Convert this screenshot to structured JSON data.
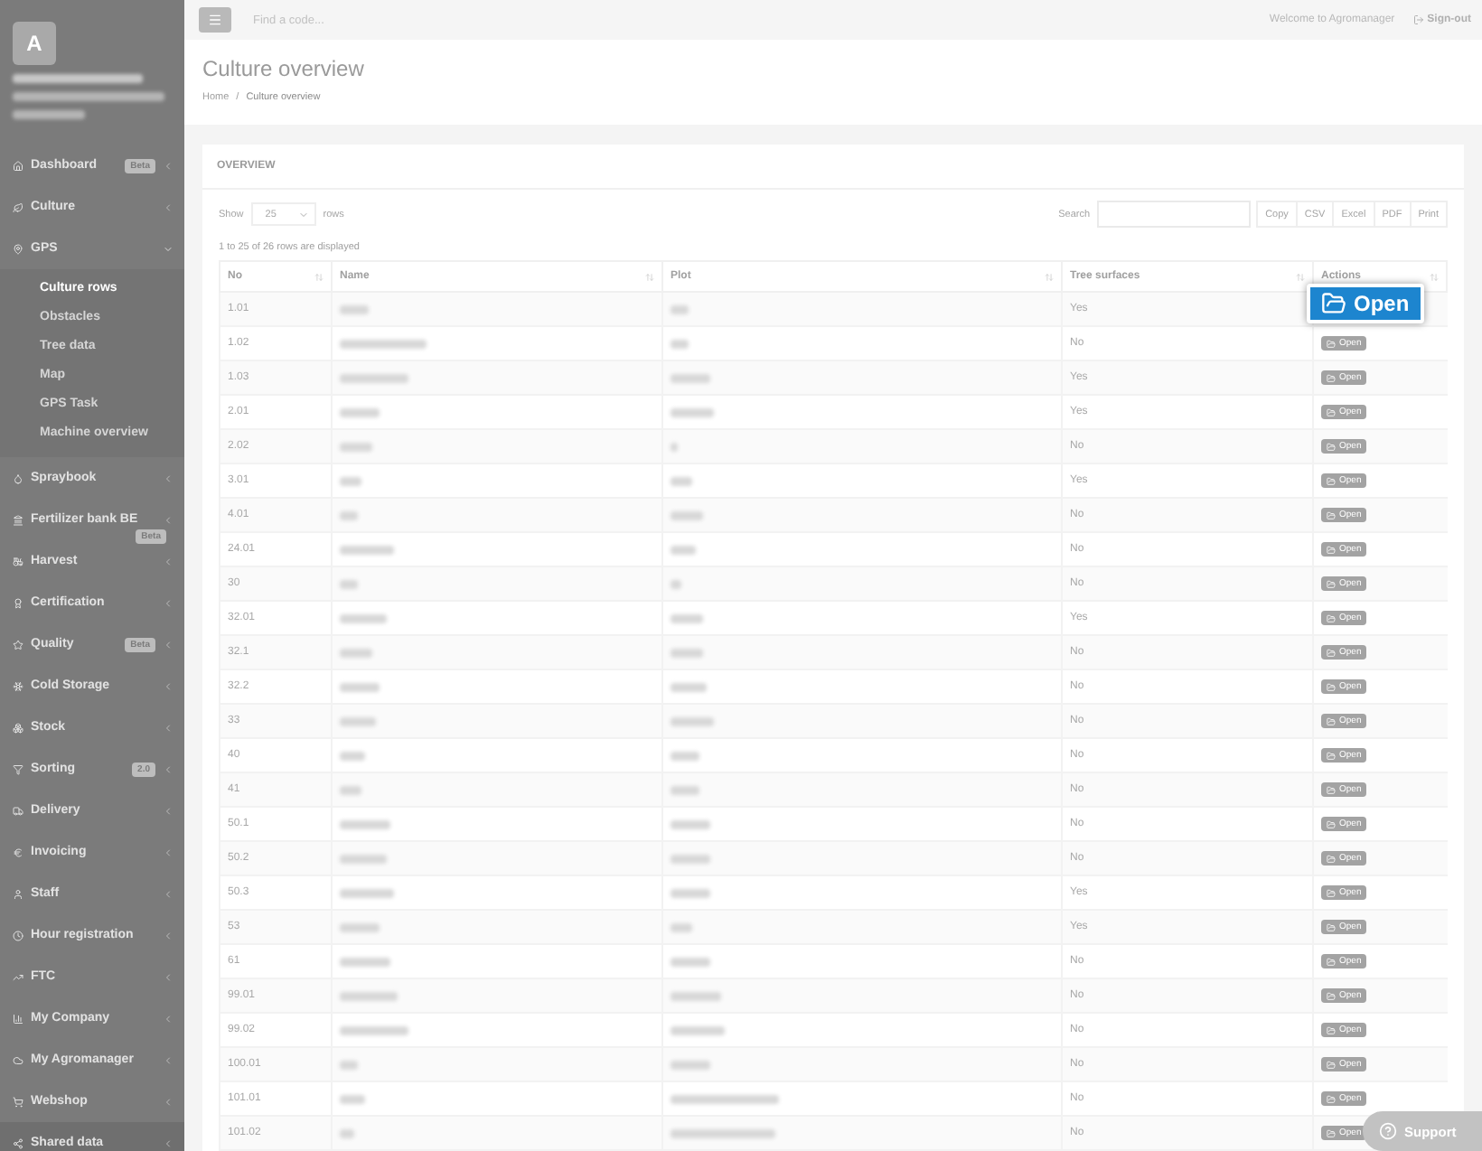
{
  "sidebar": {
    "avatar": "A",
    "items": [
      {
        "label": "Dashboard",
        "badge": "Beta",
        "expanded": false
      },
      {
        "label": "Culture",
        "expanded": false
      },
      {
        "label": "GPS",
        "expanded": true,
        "children": [
          {
            "label": "Culture rows",
            "selected": true
          },
          {
            "label": "Obstacles",
            "selected": false
          },
          {
            "label": "Tree data",
            "selected": false
          },
          {
            "label": "Map",
            "selected": false
          },
          {
            "label": "GPS Task",
            "selected": false
          },
          {
            "label": "Machine overview",
            "selected": false
          }
        ]
      },
      {
        "label": "Spraybook",
        "expanded": false
      },
      {
        "label": "Fertilizer bank BE",
        "badge": "Beta",
        "badge_below": true,
        "expanded": false
      },
      {
        "label": "Harvest",
        "expanded": false
      },
      {
        "label": "Certification",
        "expanded": false
      },
      {
        "label": "Quality",
        "badge": "Beta",
        "expanded": false
      },
      {
        "label": "Cold Storage",
        "expanded": false
      },
      {
        "label": "Stock",
        "expanded": false
      },
      {
        "label": "Sorting",
        "badge": "2.0",
        "expanded": false
      },
      {
        "label": "Delivery",
        "expanded": false
      },
      {
        "label": "Invoicing",
        "expanded": false
      },
      {
        "label": "Staff",
        "expanded": false
      },
      {
        "label": "Hour registration",
        "expanded": false
      },
      {
        "label": "FTC",
        "expanded": false
      },
      {
        "label": "My Company",
        "expanded": false
      },
      {
        "label": "My Agromanager",
        "expanded": false
      },
      {
        "label": "Webshop",
        "expanded": false
      },
      {
        "label": "Shared data",
        "expanded": false
      }
    ]
  },
  "topbar": {
    "search_placeholder": "Find a code...",
    "welcome": "Welcome to Agromanager",
    "signout": "Sign-out"
  },
  "page": {
    "title": "Culture overview",
    "breadcrumb": [
      "Home",
      "Culture overview"
    ],
    "breadcrumb_separator": "/"
  },
  "card": {
    "title": "OVERVIEW",
    "show_label": "Show",
    "page_size": "25",
    "rows_label": "rows",
    "search_label": "Search",
    "export_buttons": [
      "Copy",
      "CSV",
      "Excel",
      "PDF",
      "Print"
    ],
    "info": "1 to 25 of 26 rows are displayed"
  },
  "table": {
    "columns": [
      "No",
      "Name",
      "Plot",
      "Tree surfaces",
      "Actions"
    ],
    "rows": [
      {
        "no": "1.01",
        "tree": "Yes",
        "action": "Open",
        "highlighted": true
      },
      {
        "no": "1.02",
        "tree": "No",
        "action": "Open",
        "highlighted": false
      },
      {
        "no": "1.03",
        "tree": "Yes",
        "action": "Open",
        "highlighted": false
      },
      {
        "no": "2.01",
        "tree": "Yes",
        "action": "Open",
        "highlighted": false
      },
      {
        "no": "2.02",
        "tree": "No",
        "action": "Open",
        "highlighted": false
      },
      {
        "no": "3.01",
        "tree": "Yes",
        "action": "Open",
        "highlighted": false
      },
      {
        "no": "4.01",
        "tree": "No",
        "action": "Open",
        "highlighted": false
      },
      {
        "no": "24.01",
        "tree": "No",
        "action": "Open",
        "highlighted": false
      },
      {
        "no": "30",
        "tree": "No",
        "action": "Open",
        "highlighted": false
      },
      {
        "no": "32.01",
        "tree": "Yes",
        "action": "Open",
        "highlighted": false
      },
      {
        "no": "32.1",
        "tree": "No",
        "action": "Open",
        "highlighted": false
      },
      {
        "no": "32.2",
        "tree": "No",
        "action": "Open",
        "highlighted": false
      },
      {
        "no": "33",
        "tree": "No",
        "action": "Open",
        "highlighted": false
      },
      {
        "no": "40",
        "tree": "No",
        "action": "Open",
        "highlighted": false
      },
      {
        "no": "41",
        "tree": "No",
        "action": "Open",
        "highlighted": false
      },
      {
        "no": "50.1",
        "tree": "No",
        "action": "Open",
        "highlighted": false
      },
      {
        "no": "50.2",
        "tree": "No",
        "action": "Open",
        "highlighted": false
      },
      {
        "no": "50.3",
        "tree": "Yes",
        "action": "Open",
        "highlighted": false
      },
      {
        "no": "53",
        "tree": "Yes",
        "action": "Open",
        "highlighted": false
      },
      {
        "no": "61",
        "tree": "No",
        "action": "Open",
        "highlighted": false
      },
      {
        "no": "99.01",
        "tree": "No",
        "action": "Open",
        "highlighted": false
      },
      {
        "no": "99.02",
        "tree": "No",
        "action": "Open",
        "highlighted": false
      },
      {
        "no": "100.01",
        "tree": "No",
        "action": "Open",
        "highlighted": false
      },
      {
        "no": "101.01",
        "tree": "No",
        "action": "Open",
        "highlighted": false
      },
      {
        "no": "101.02",
        "tree": "No",
        "action": "Open",
        "highlighted": false
      }
    ]
  },
  "support": "Support"
}
